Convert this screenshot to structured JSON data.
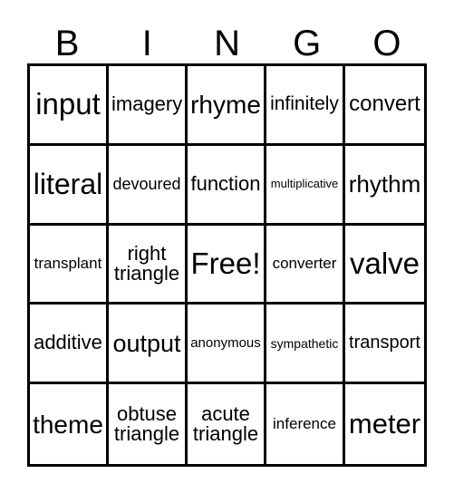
{
  "card": {
    "header": {
      "letters": [
        "B",
        "I",
        "N",
        "G",
        "O"
      ]
    },
    "grid": {
      "rows": 5,
      "columns": 5,
      "border_color": "#000000",
      "background_color": "#ffffff",
      "text_color": "#000000",
      "cells": [
        [
          {
            "text": "input",
            "size": "xl"
          },
          {
            "text": "imagery",
            "size": "md"
          },
          {
            "text": "rhyme",
            "size": "xl"
          },
          {
            "text": "infinitely",
            "size": "md"
          },
          {
            "text": "convert",
            "size": "lg"
          }
        ],
        [
          {
            "text": "literal",
            "size": "xl"
          },
          {
            "text": "devoured",
            "size": "md"
          },
          {
            "text": "function",
            "size": "lg"
          },
          {
            "text": "multiplicative",
            "size": "xs"
          },
          {
            "text": "rhythm",
            "size": "lg"
          }
        ],
        [
          {
            "text": "transplant",
            "size": "sm"
          },
          {
            "text": "right triangle",
            "size": "md"
          },
          {
            "text": "Free!",
            "size": "xl"
          },
          {
            "text": "converter",
            "size": "sm"
          },
          {
            "text": "valve",
            "size": "xl"
          }
        ],
        [
          {
            "text": "additive",
            "size": "lg"
          },
          {
            "text": "output",
            "size": "lg"
          },
          {
            "text": "anonymous",
            "size": "sm"
          },
          {
            "text": "sympathetic",
            "size": "sm"
          },
          {
            "text": "transport",
            "size": "md"
          }
        ],
        [
          {
            "text": "theme",
            "size": "xl"
          },
          {
            "text": "obtuse triangle",
            "size": "md"
          },
          {
            "text": "acute triangle",
            "size": "md"
          },
          {
            "text": "inference",
            "size": "sm"
          },
          {
            "text": "meter",
            "size": "xl"
          }
        ]
      ]
    }
  }
}
